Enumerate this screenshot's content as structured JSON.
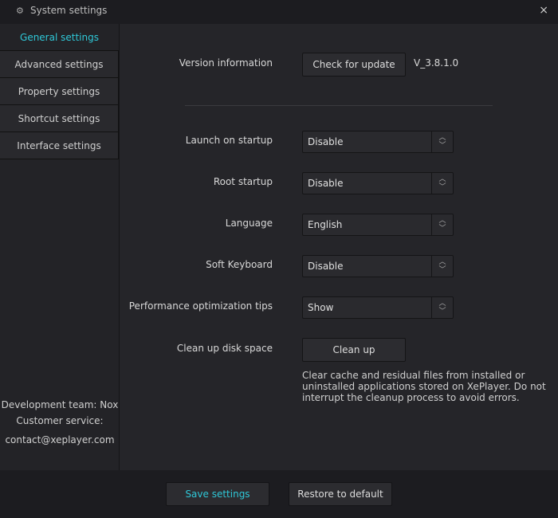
{
  "window": {
    "title": "System settings",
    "close": "×"
  },
  "sidebar": {
    "items": [
      {
        "label": "General settings"
      },
      {
        "label": "Advanced settings"
      },
      {
        "label": "Property settings"
      },
      {
        "label": "Shortcut settings"
      },
      {
        "label": "Interface settings"
      }
    ],
    "footer": {
      "team": "Development team: Nox",
      "service": "Customer service:",
      "email": "contact@xeplayer.com"
    }
  },
  "main": {
    "version": {
      "label": "Version information",
      "button": "Check for update",
      "value": "V_3.8.1.0"
    },
    "launch": {
      "label": "Launch on startup",
      "value": "Disable"
    },
    "root": {
      "label": "Root startup",
      "value": "Disable"
    },
    "language": {
      "label": "Language",
      "value": "English"
    },
    "keyboard": {
      "label": "Soft Keyboard",
      "value": "Disable"
    },
    "perf": {
      "label": "Performance optimization tips",
      "value": "Show"
    },
    "cleanup": {
      "label": "Clean up disk space",
      "button": "Clean up",
      "desc": "Clear cache and residual files from installed or uninstalled applications stored on XePlayer. Do not interrupt the cleanup process to avoid errors."
    }
  },
  "footer": {
    "save": "Save settings",
    "restore": "Restore to default"
  },
  "colors": {
    "accent": "#2fc8d8"
  }
}
